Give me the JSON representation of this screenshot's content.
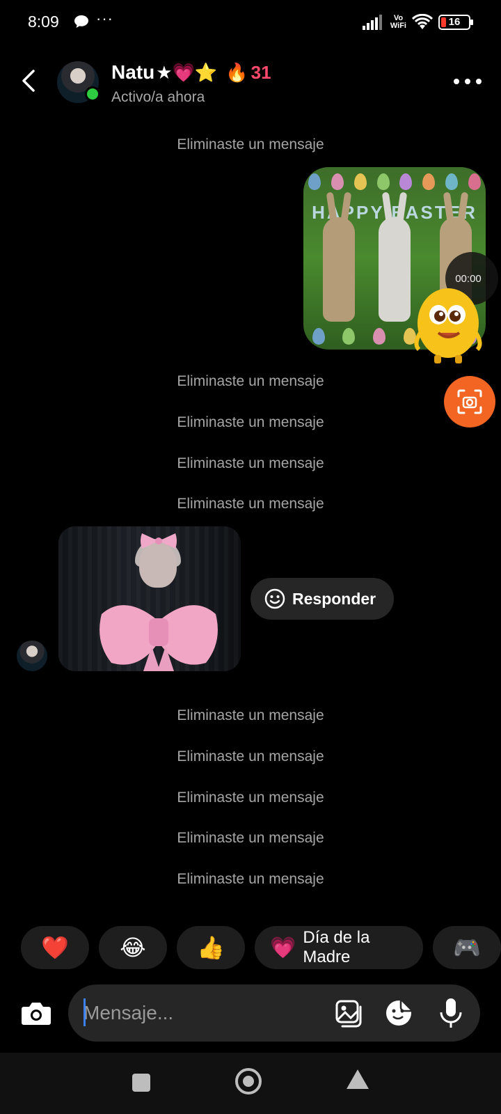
{
  "status_bar": {
    "time": "8:09",
    "dots": "···",
    "vowifi_top": "Vo",
    "vowifi_bottom": "WiFi",
    "battery": "16"
  },
  "header": {
    "contact_name": "Natu",
    "name_emojis": "★💗⭐",
    "streak_icon": "🔥",
    "streak_count": "31",
    "status": "Activo/a ahora"
  },
  "messages": {
    "deleted_label": "Eliminaste un mensaje",
    "deleted_group_1": [
      "Eliminaste un mensaje"
    ],
    "deleted_group_2": [
      "Eliminaste un mensaje",
      "Eliminaste un mensaje",
      "Eliminaste un mensaje",
      "Eliminaste un mensaje"
    ],
    "deleted_group_3": [
      "Eliminaste un mensaje",
      "Eliminaste un mensaje",
      "Eliminaste un mensaje",
      "Eliminaste un mensaje",
      "Eliminaste un mensaje"
    ],
    "sent_media_text": "HAPPY EASTER",
    "sent_media_timer": "00:00",
    "reply_label": "Responder"
  },
  "quick_reactions": [
    {
      "emoji": "❤️"
    },
    {
      "emoji": "😂"
    },
    {
      "emoji": "👍"
    },
    {
      "emoji": "💗",
      "label": "Día de la Madre"
    },
    {
      "emoji": "🎮"
    }
  ],
  "composer": {
    "placeholder": "Mensaje..."
  },
  "colors": {
    "accent_orange": "#f26522",
    "online_green": "#2ecc40",
    "streak_red": "#ff4a6b"
  }
}
